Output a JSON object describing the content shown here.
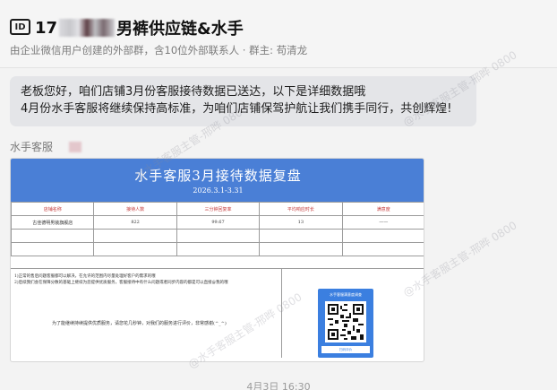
{
  "chat": {
    "title_prefix": "17",
    "title_suffix": "男裤供应链&水手",
    "subtitle": "由企业微信用户创建的外部群，含10位外部联系人 · 群主: 苟清龙"
  },
  "message": {
    "line1": "老板您好，咱们店铺3月份客服接待数据已送达，以下是详细数据哦",
    "line2": "4月份水手客服将继续保持高标准，为咱们店铺保驾护航让我们携手同行，共创辉煌!"
  },
  "sender": {
    "name": "水手客服"
  },
  "report": {
    "title": "水手客服3月接待数据复盘",
    "date": "2026.3.1-3.31",
    "headers": [
      "店铺名称",
      "接待人数",
      "三分钟回复率",
      "平均响应时长",
      "满意度"
    ],
    "row": [
      "古佳德明男装旗舰店",
      "822",
      "99.67",
      "13",
      "——"
    ],
    "notes": [
      "1)正常的售后问题客服都可以解决，在允许的范围内尽量处理好客户的需求的哦",
      "2)后续我们会在保障分数的基础上继续为您提供优质服务，客服接待中有什么问题或者同步内容的都是可以直接@我的哦"
    ],
    "thanks": "为了能继续持续提供优质服务，请您花几秒钟，对我们的服务进行评价，非常感谢(^_^)",
    "qr_title": "水手客服满意度调查",
    "qr_footer": "扫码评价"
  },
  "timestamp": "4月3日 16:30",
  "watermark": "@水手客服主管-邢晔 0800"
}
